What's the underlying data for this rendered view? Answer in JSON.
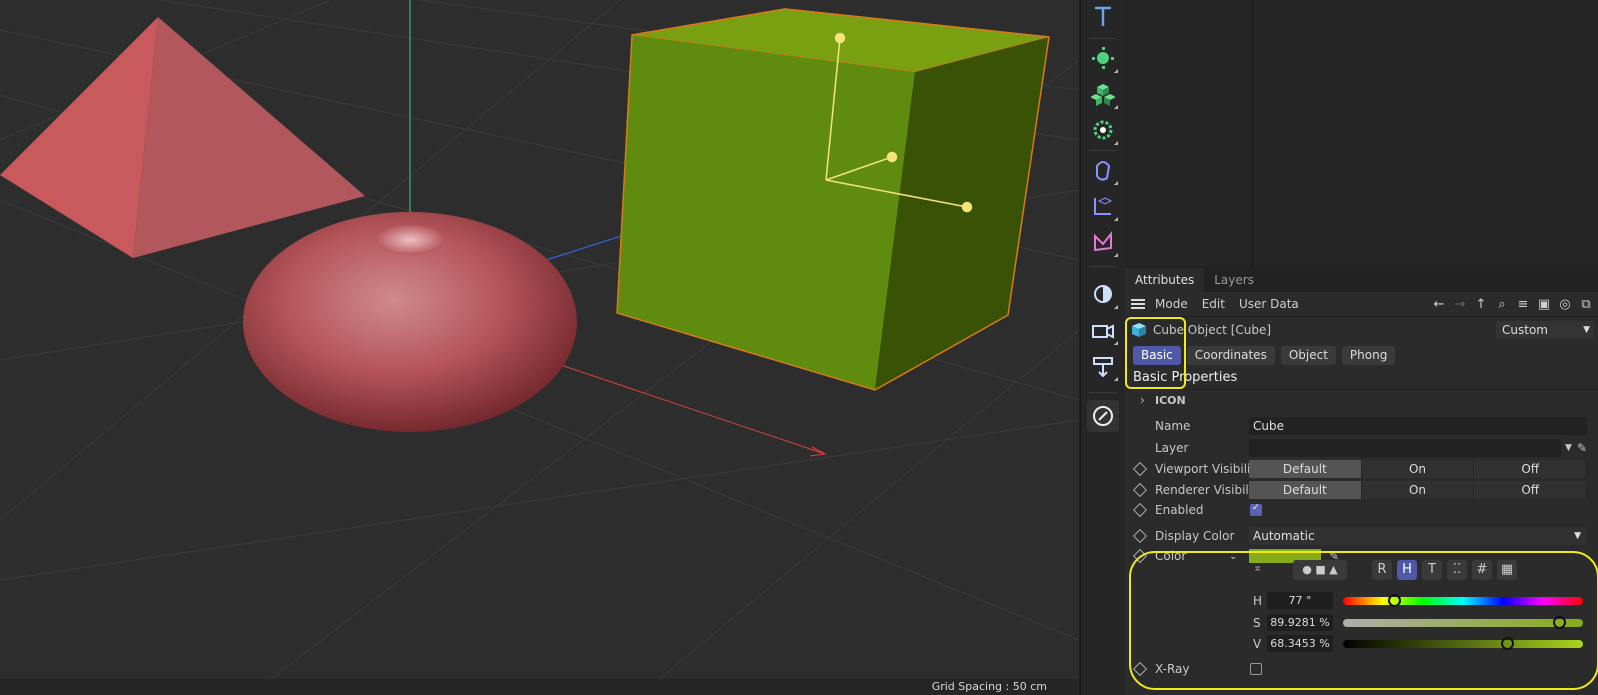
{
  "viewport": {
    "grid_spacing": "Grid Spacing : 50 cm"
  },
  "toolbar": {
    "items": [
      "text-tool",
      "generators",
      "objects",
      "deformers",
      "splines",
      "coordinates",
      "fields",
      "lights",
      "camera",
      "floor",
      "edit-tool"
    ]
  },
  "attributes": {
    "tabs": [
      "Attributes",
      "Layers"
    ],
    "menu": [
      "Mode",
      "Edit",
      "User Data"
    ],
    "object_title": "Cube Object [Cube]",
    "preset": "Custom",
    "subtabs": [
      "Basic",
      "Coordinates",
      "Object",
      "Phong"
    ],
    "section_title": "Basic Properties",
    "icon_group": "ICON",
    "name_label": "Name",
    "name_value": "Cube",
    "layer_label": "Layer",
    "viewport_visibility_label": "Viewport Visibility",
    "renderer_visibility_label": "Renderer Visibility",
    "visibility_options": [
      "Default",
      "On",
      "Off"
    ],
    "enabled_label": "Enabled",
    "display_color_label": "Display Color",
    "display_color_value": "Automatic",
    "color_label": "Color",
    "color_hex": "#86ad17",
    "color_modes": [
      "R",
      "H",
      "T",
      "⁚⁚",
      "#",
      "▦"
    ],
    "h_label": "H",
    "h_value": "77 °",
    "h_fraction": 0.214,
    "s_label": "S",
    "s_value": "89.9281 %",
    "s_fraction": 0.899,
    "v_label": "V",
    "v_value": "68.3453 %",
    "v_fraction": 0.683,
    "xray_label": "X-Ray"
  },
  "colors": {
    "accent": "#5058a8",
    "highlight": "#f2e81a"
  }
}
